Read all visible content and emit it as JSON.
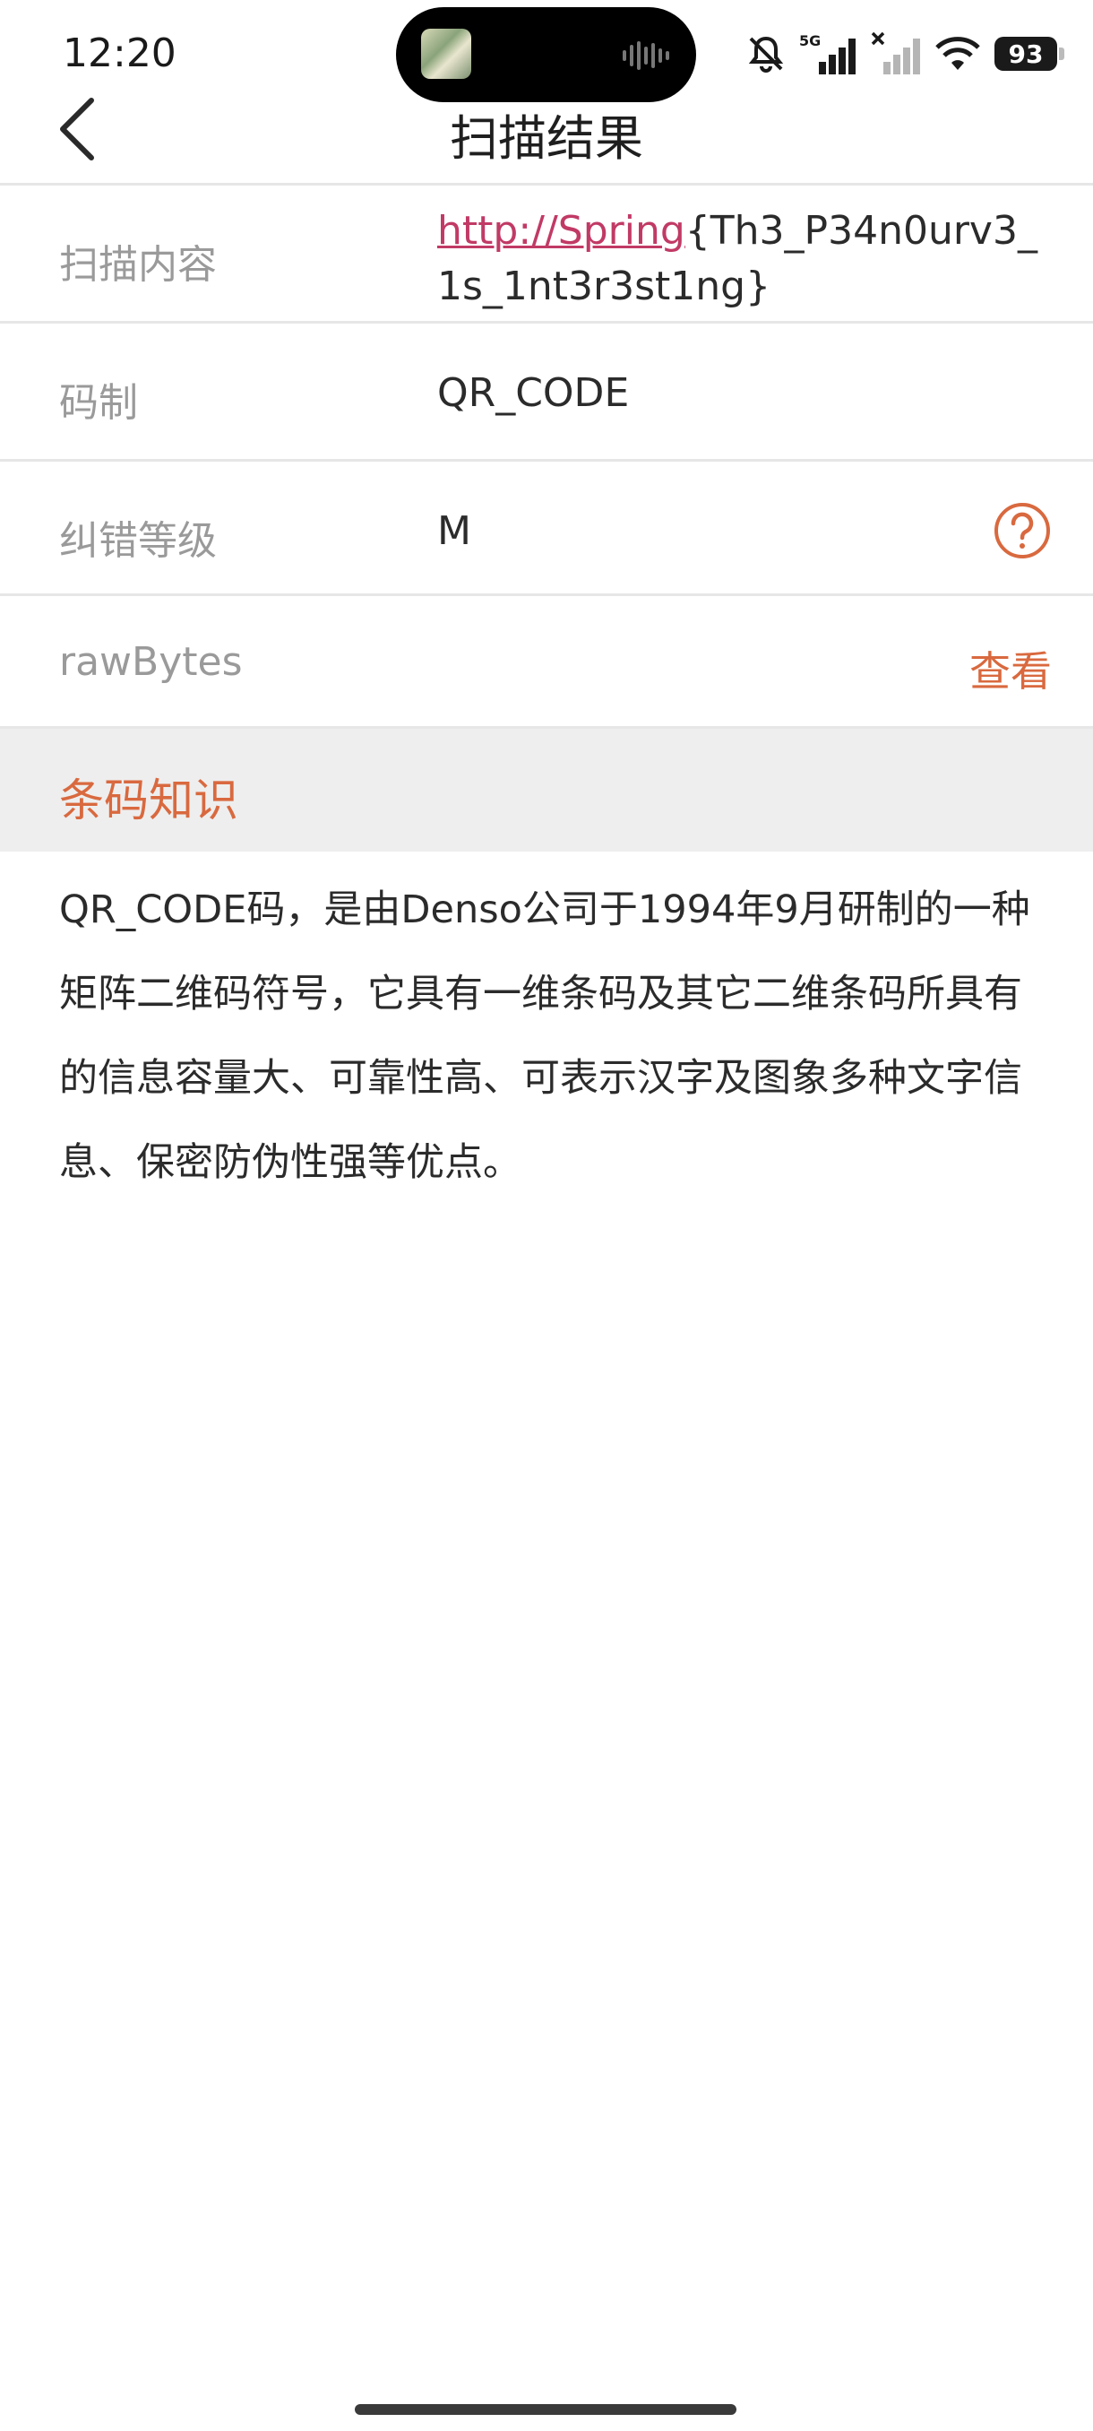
{
  "status_bar": {
    "time": "12:20",
    "network": "5G",
    "battery": "93"
  },
  "header": {
    "title": "扫描结果",
    "back_icon": "chevron-left-icon"
  },
  "rows": {
    "content": {
      "label": "扫描内容",
      "link_text": "http://Spring",
      "rest_text": "{Th3_P34n0urv3_1s_1nt3r3st1ng}"
    },
    "code_type": {
      "label": "码制",
      "value": "QR_CODE"
    },
    "error_level": {
      "label": "纠错等级",
      "value": "M",
      "help_icon": "question-circle-icon"
    },
    "raw_bytes": {
      "label": "rawBytes",
      "action": "查看"
    }
  },
  "knowledge": {
    "title": "条码知识",
    "text": "QR_CODE码，是由Denso公司于1994年9月研制的一种矩阵二维码符号，它具有一维条码及其它二维条码所具有的信息容量大、可靠性高、可表示汉字及图象多种文字信息、保密防伪性强等优点。"
  },
  "colors": {
    "accent": "#d9693f",
    "link": "#c13a66",
    "label": "#9a9a9a",
    "section_bg": "#eeeeee"
  }
}
